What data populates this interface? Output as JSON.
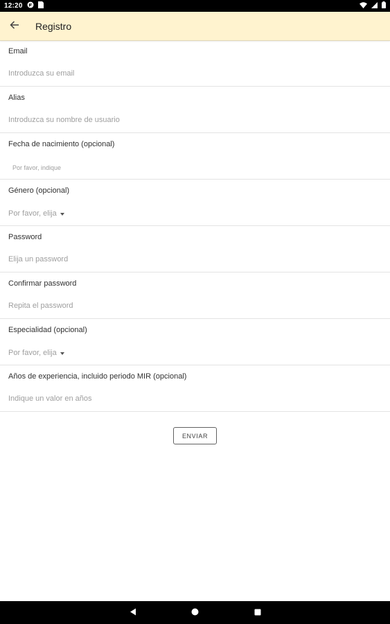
{
  "status_bar": {
    "time": "12:20",
    "left_icons": [
      "cast-icon",
      "sim-icon"
    ],
    "right_icons": [
      "wifi-icon",
      "signal-icon",
      "battery-icon"
    ]
  },
  "app_bar": {
    "title": "Registro",
    "background": "#fff3cf"
  },
  "form": {
    "email": {
      "label": "Email",
      "placeholder": "Introduzca su email"
    },
    "alias": {
      "label": "Alias",
      "placeholder": "Introduzca su nombre de usuario"
    },
    "birthdate": {
      "label": "Fecha de nacimiento (opcional)",
      "placeholder": "Por favor, indique"
    },
    "gender": {
      "label": "Género (opcional)",
      "selected": "Por favor, elija"
    },
    "password": {
      "label": "Password",
      "placeholder": "Elija un password"
    },
    "confirm_password": {
      "label": "Confirmar password",
      "placeholder": "Repita el password"
    },
    "specialty": {
      "label": "Especialidad (opcional)",
      "selected": "Por favor, elija"
    },
    "experience": {
      "label": "Años de experiencia, incluido periodo MIR (opcional)",
      "placeholder": "Indique un valor en años"
    }
  },
  "submit": {
    "label": "ENVIAR"
  },
  "nav_bar": {
    "buttons": [
      "back-icon",
      "home-icon",
      "recents-icon"
    ]
  }
}
